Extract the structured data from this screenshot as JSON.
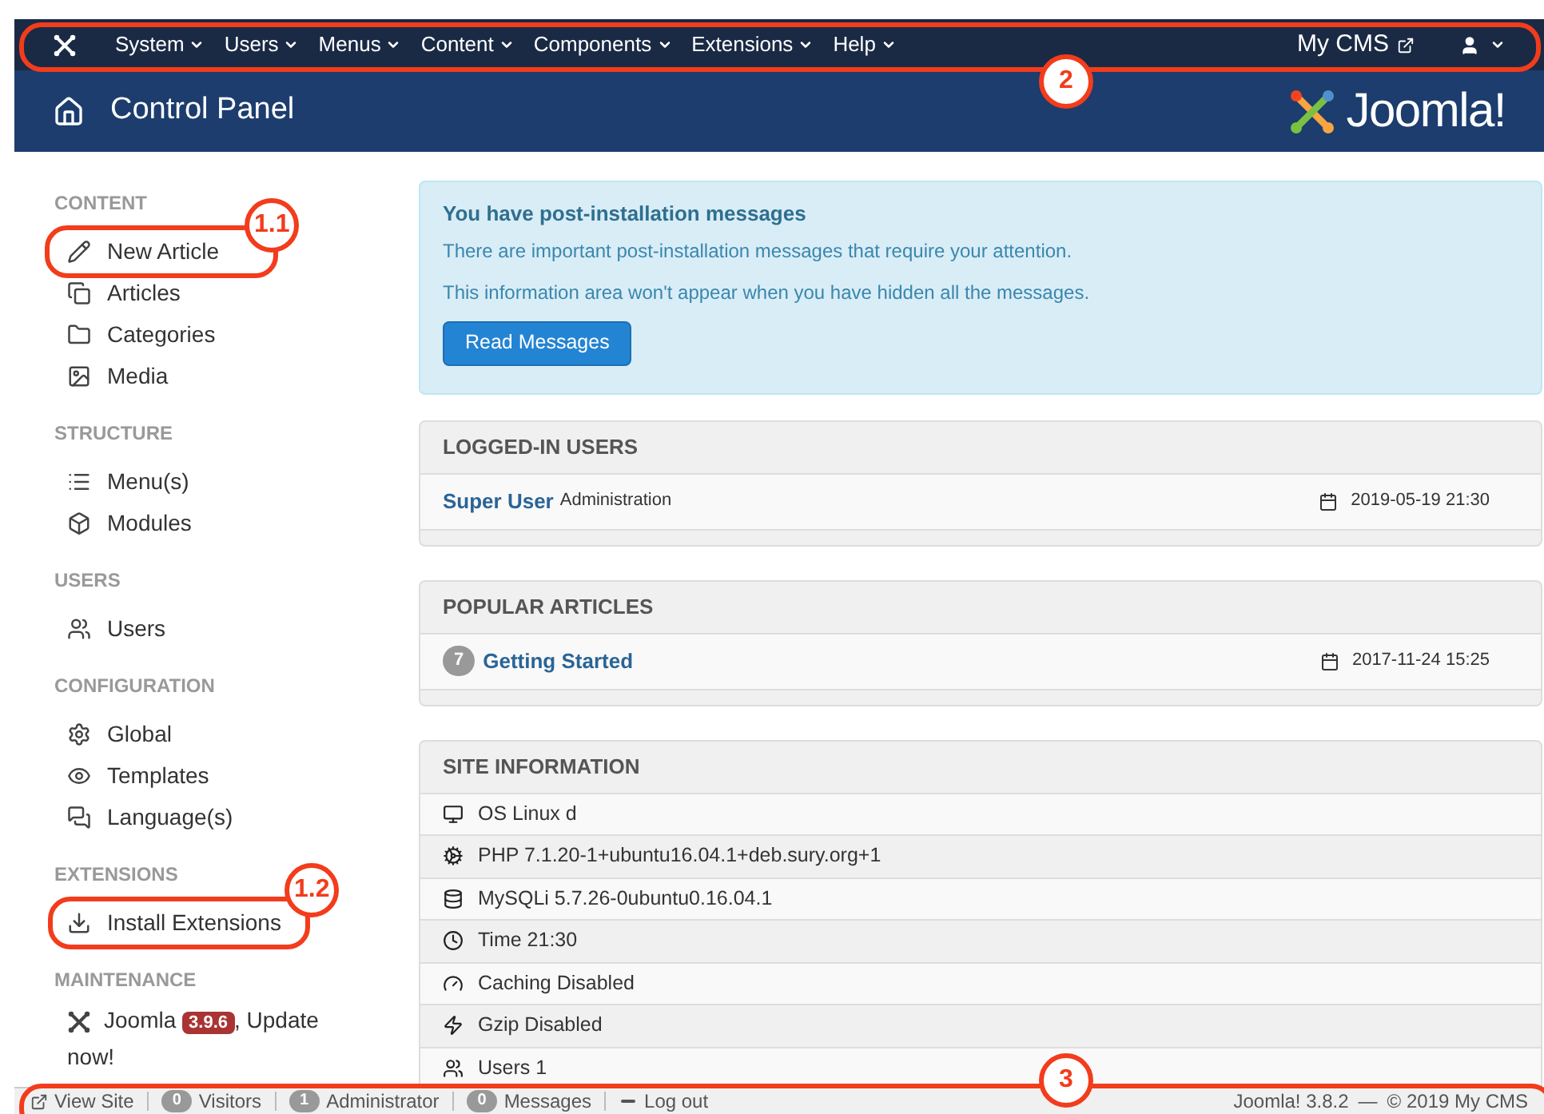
{
  "navbar": {
    "menus": [
      {
        "label": "System"
      },
      {
        "label": "Users"
      },
      {
        "label": "Menus"
      },
      {
        "label": "Content"
      },
      {
        "label": "Components"
      },
      {
        "label": "Extensions"
      },
      {
        "label": "Help"
      }
    ],
    "site_link": "My CMS"
  },
  "header": {
    "title": "Control Panel",
    "logo_text": "Joomla!"
  },
  "sidebar": {
    "sections": [
      {
        "heading": "CONTENT",
        "items": [
          {
            "label": "New Article"
          },
          {
            "label": "Articles"
          },
          {
            "label": "Categories"
          },
          {
            "label": "Media"
          }
        ]
      },
      {
        "heading": "STRUCTURE",
        "items": [
          {
            "label": "Menu(s)"
          },
          {
            "label": "Modules"
          }
        ]
      },
      {
        "heading": "USERS",
        "items": [
          {
            "label": "Users"
          }
        ]
      },
      {
        "heading": "CONFIGURATION",
        "items": [
          {
            "label": "Global"
          },
          {
            "label": "Templates"
          },
          {
            "label": "Language(s)"
          }
        ]
      },
      {
        "heading": "EXTENSIONS",
        "items": [
          {
            "label": "Install Extensions"
          }
        ]
      },
      {
        "heading": "MAINTENANCE"
      }
    ],
    "update": {
      "label": "Joomla",
      "version": "3.9.6",
      "suffix": ", Update now!"
    }
  },
  "alert": {
    "title": "You have post-installation messages",
    "lines": [
      "There are important post-installation messages that require your attention.",
      "This information area won't appear when you have hidden all the messages."
    ],
    "button": "Read Messages"
  },
  "logged_in_users": {
    "heading": "LOGGED-IN USERS",
    "rows": [
      {
        "name": "Super User",
        "role": "Administration",
        "date": "2019-05-19 21:30"
      }
    ]
  },
  "popular_articles": {
    "heading": "POPULAR ARTICLES",
    "rows": [
      {
        "hits": "7",
        "title": "Getting Started",
        "date": "2017-11-24 15:25"
      }
    ]
  },
  "site_information": {
    "heading": "SITE INFORMATION",
    "rows": [
      "OS Linux d",
      "PHP 7.1.20-1+ubuntu16.04.1+deb.sury.org+1",
      "MySQLi 5.7.26-0ubuntu0.16.04.1",
      "Time 21:30",
      "Caching Disabled",
      "Gzip Disabled",
      "Users 1"
    ]
  },
  "status_bar": {
    "items": [
      {
        "kind": "link",
        "label": "View Site"
      },
      {
        "kind": "count",
        "count": "0",
        "label": "Visitors"
      },
      {
        "kind": "count",
        "count": "1",
        "label": "Administrator"
      },
      {
        "kind": "count",
        "count": "0",
        "label": "Messages"
      },
      {
        "kind": "logout",
        "label": "Log out"
      }
    ],
    "version": "Joomla! 3.8.2",
    "separator": "—",
    "copyright": "© 2019 My CMS"
  },
  "annotations": [
    {
      "label": "2"
    },
    {
      "label": "1.1"
    },
    {
      "label": "1.2"
    },
    {
      "label": "3"
    }
  ]
}
